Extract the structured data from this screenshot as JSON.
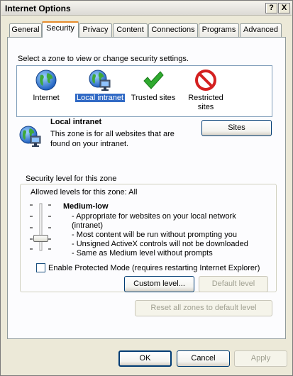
{
  "window": {
    "title": "Internet Options",
    "help_label": "?",
    "close_label": "X"
  },
  "tabs": [
    {
      "label": "General"
    },
    {
      "label": "Security"
    },
    {
      "label": "Privacy"
    },
    {
      "label": "Content"
    },
    {
      "label": "Connections"
    },
    {
      "label": "Programs"
    },
    {
      "label": "Advanced"
    }
  ],
  "active_tab": "Security",
  "zone_prompt": "Select a zone to view or change security settings.",
  "zones": [
    {
      "label": "Internet",
      "icon": "globe-icon"
    },
    {
      "label": "Local intranet",
      "icon": "intranet-icon",
      "selected": true
    },
    {
      "label": "Trusted sites",
      "icon": "checkmark-icon"
    },
    {
      "label": "Restricted sites",
      "line1": "Restricted",
      "line2": "sites",
      "icon": "restricted-icon"
    }
  ],
  "zone_info": {
    "title": "Local intranet",
    "description_line1": "This zone is for all websites that are",
    "description_line2": "found on your intranet.",
    "sites_button": "Sites"
  },
  "security_level": {
    "group_title": "Security level for this zone",
    "allowed_levels": "Allowed levels for this zone: All",
    "level_name": "Medium-low",
    "details": [
      "- Appropriate for websites on your local network",
      "(intranet)",
      "- Most content will be run without prompting you",
      "- Unsigned ActiveX controls will not be downloaded",
      "- Same as Medium level without prompts"
    ],
    "slider_level_fraction": 0.25,
    "protected_mode_label": "Enable Protected Mode (requires restarting Internet Explorer)",
    "protected_mode_checked": false,
    "custom_level_button": "Custom level...",
    "default_level_button": "Default level"
  },
  "reset_all_button": "Reset all zones to default level",
  "footer": {
    "ok": "OK",
    "cancel": "Cancel",
    "apply": "Apply"
  },
  "colors": {
    "selection": "#316ac5",
    "tab_highlight": "#e68b2c",
    "face": "#ece9d8"
  }
}
